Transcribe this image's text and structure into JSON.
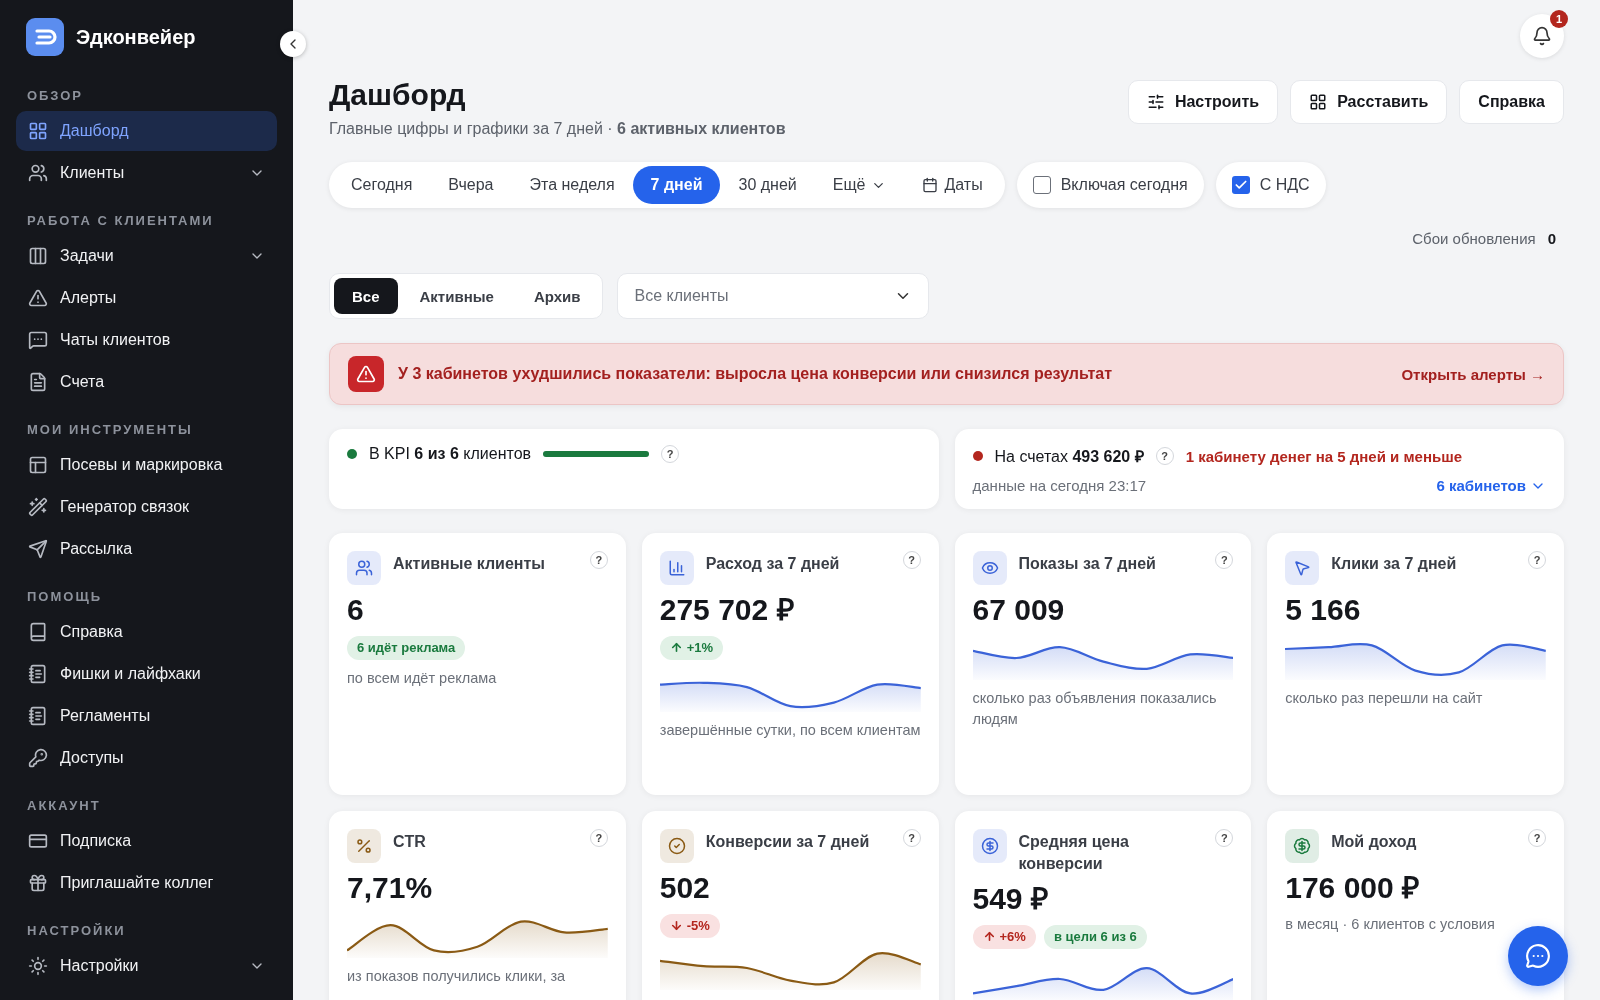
{
  "brand": {
    "name": "Эдконвейер"
  },
  "sidebar": {
    "sections": [
      {
        "title": "ОБЗОР",
        "items": [
          {
            "label": "Дашборд",
            "selected": true
          },
          {
            "label": "Клиенты",
            "selected": false,
            "expanded": false
          }
        ]
      },
      {
        "title": "РАБОТА С КЛИЕНТАМИ",
        "items": [
          {
            "label": "Задачи",
            "selected": false,
            "expanded": false
          },
          {
            "label": "Алерты",
            "selected": false
          },
          {
            "label": "Чаты клиентов",
            "selected": false
          },
          {
            "label": "Счета",
            "selected": false
          }
        ]
      },
      {
        "title": "МОИ ИНСТРУМЕНТЫ",
        "items": [
          {
            "label": "Посевы и маркировка",
            "selected": false
          },
          {
            "label": "Генератор связок",
            "selected": false
          },
          {
            "label": "Рассылка",
            "selected": false
          }
        ]
      },
      {
        "title": "ПОМОЩЬ",
        "items": [
          {
            "label": "Справка",
            "selected": false
          },
          {
            "label": "Фишки и лайфхаки",
            "selected": false
          },
          {
            "label": "Регламенты",
            "selected": false
          },
          {
            "label": "Доступы",
            "selected": false
          }
        ]
      },
      {
        "title": "АККАУНТ",
        "items": [
          {
            "label": "Подписка",
            "selected": false
          },
          {
            "label": "Приглашайте коллег",
            "selected": false
          }
        ]
      },
      {
        "title": "НАСТРОЙКИ",
        "items": [
          {
            "label": "Настройки",
            "selected": false,
            "expanded": false
          }
        ]
      }
    ]
  },
  "notifications": {
    "count": "1"
  },
  "page": {
    "title": "Дашборд",
    "subtitle": "Главные цифры и графики за 7 дней · **6 активных клиентов**"
  },
  "header_buttons": [
    {
      "label": "Настроить"
    },
    {
      "label": "Расставить"
    },
    {
      "label": "Справка"
    }
  ],
  "period_tabs": [
    {
      "label": "Сегодня",
      "kind": "plain",
      "selected": false
    },
    {
      "label": "Вчера",
      "kind": "plain",
      "selected": false
    },
    {
      "label": "Эта неделя",
      "kind": "plain",
      "selected": false
    },
    {
      "label": "7 дней",
      "kind": "plain",
      "selected": true
    },
    {
      "label": "30 дней",
      "kind": "plain",
      "selected": false
    },
    {
      "label": "Ещё",
      "kind": "dropdown",
      "selected": false
    },
    {
      "label": "Даты",
      "kind": "dates",
      "selected": false
    }
  ],
  "toggles": [
    {
      "label": "Включая сегодня",
      "checked": false
    },
    {
      "label": "С НДС",
      "checked": true
    }
  ],
  "update_failures": {
    "label": "Сбои обновления",
    "value": "0"
  },
  "status_filter": [
    {
      "label": "Все",
      "selected": true
    },
    {
      "label": "Активные",
      "selected": false
    },
    {
      "label": "Архив",
      "selected": false
    }
  ],
  "client_select": {
    "value": "Все клиенты"
  },
  "alert": {
    "text": "У 3 кабинетов ухудшились показатели: выросла цена конверсии или снизился результат",
    "link": "Открыть алерты →"
  },
  "kpi": {
    "text": "В KPI **6 из 6** клиентов",
    "color": "#1a7a3e",
    "level": 1,
    "help": "?"
  },
  "balance": {
    "text": "На счетах **493 620 ₽**",
    "color": "#b3261e",
    "help": "?",
    "warning": "1 кабинету денег на 5 дней и меньше",
    "note": "данные на сегодня 23:17",
    "link": "6 кабинетов"
  },
  "metrics": [
    {
      "title": "Активные клиенты",
      "kind": "plain",
      "color": "#3b63d8",
      "value": "6",
      "badges": [
        {
          "text": "6 идёт реклама",
          "kind": "good"
        }
      ],
      "caption": "по всем идёт реклама",
      "help": "?"
    },
    {
      "title": "Расход за 7 дней",
      "kind": "chart",
      "color": "#3b63d8",
      "value": "275 702 ₽",
      "badges": [
        {
          "text": "+1%",
          "kind": "up_good"
        }
      ],
      "caption": "завершённые сутки, по всем клиентам",
      "help": "?"
    },
    {
      "title": "Показы за 7 дней",
      "kind": "chart",
      "color": "#3b63d8",
      "value": "67 009",
      "caption": "сколько раз объявления показались людям",
      "help": "?"
    },
    {
      "title": "Клики за 7 дней",
      "kind": "chart",
      "color": "#3b63d8",
      "value": "5 166",
      "caption": "сколько раз перешли на сайт",
      "help": "?"
    },
    {
      "title": "CTR",
      "kind": "chart",
      "color": "#8a5a14",
      "value": "7,71%",
      "caption": "из показов получились клики, за",
      "help": "?"
    },
    {
      "title": "Конверсии за 7 дней",
      "kind": "chart",
      "color": "#8a5a14",
      "value": "502",
      "badges": [
        {
          "text": "-5%",
          "kind": "down_bad"
        }
      ],
      "help": "?"
    },
    {
      "title": "Средняя цена конверсии",
      "kind": "chart",
      "color": "#3b63d8",
      "value": "549 ₽",
      "badges": [
        {
          "text": "+6%",
          "kind": "up_bad"
        },
        {
          "text": "в цели 6 из 6",
          "kind": "good"
        }
      ],
      "help": "?"
    },
    {
      "title": "Мой доход",
      "kind": "plain",
      "color": "#1a7a3e",
      "value": "176 000 ₽",
      "caption": "в месяц · 6 клиентов с условия",
      "help": "?"
    }
  ]
}
